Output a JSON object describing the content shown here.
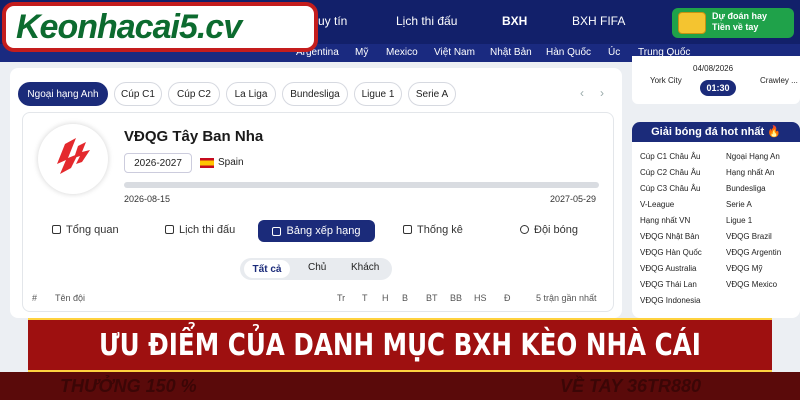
{
  "brand": {
    "logo_text": "Keonhacai5.cv"
  },
  "topnav": {
    "items": [
      "uy tín",
      "Lịch thi đấu",
      "BXH",
      "BXH FIFA"
    ],
    "promo_line1": "Dự đoán hay",
    "promo_line2": "Tiền về tay"
  },
  "countrybar": [
    "Argentina",
    "Mỹ",
    "Mexico",
    "Việt Nam",
    "Nhật Bản",
    "Hàn Quốc",
    "Úc",
    "Trung Quốc"
  ],
  "league_tabs": [
    "Ngoại hạng Anh",
    "Cúp C1",
    "Cúp C2",
    "La Liga",
    "Bundesliga",
    "Ligue 1",
    "Serie A"
  ],
  "nav_arrows": {
    "prev": "‹",
    "next": "›"
  },
  "league": {
    "title": "VĐQG Tây Ban Nha",
    "season": "2026-2027",
    "country": "Spain",
    "start_date": "2026-08-15",
    "end_date": "2027-05-29",
    "progress": 0.0
  },
  "sub_tabs": [
    "Tổng quan",
    "Lịch thi đấu",
    "Bảng xếp hạng",
    "Thống kê",
    "Đội bóng"
  ],
  "filters": [
    "Tất cả",
    "Chủ",
    "Khách"
  ],
  "table_headers": [
    "#",
    "Tên đội",
    "Tr",
    "T",
    "H",
    "B",
    "BT",
    "BB",
    "HS",
    "Đ",
    "5 trận gần nhất"
  ],
  "match": {
    "home": "York City",
    "away": "Crawley ...",
    "date": "04/08/2026",
    "time": "01:30"
  },
  "hot_leagues": {
    "title": "Giải bóng đá hot nhất 🔥",
    "left": [
      "Cúp C1 Châu Âu",
      "Cúp C2 Châu Âu",
      "Cúp C3 Châu Âu",
      "V-League",
      "Hạng nhất VN",
      "VĐQG Nhật Bản",
      "VĐQG Hàn Quốc",
      "VĐQG Australia",
      "VĐQG Thái Lan",
      "VĐQG Indonesia"
    ],
    "right": [
      "Ngoại Hạng An",
      "Hạng nhất An",
      "Bundesliga",
      "Serie A",
      "Ligue 1",
      "VĐQG Brazil",
      "VĐQG Argentin",
      "VĐQG Mỹ",
      "VĐQG Mexico"
    ]
  },
  "banner": {
    "title": "ƯU ĐIỂM CỦA DANH MỤC BXH KÈO NHÀ CÁI",
    "ghost_left": "THƯỞNG 150 %",
    "ghost_right": "VỀ TAY 36TR880"
  },
  "colors": {
    "navy": "#1b2b7a",
    "banner_red": "#9e1010",
    "accent_red": "#e4292d",
    "gold": "#ffd23f",
    "logo_green": "#0c6b2f"
  }
}
